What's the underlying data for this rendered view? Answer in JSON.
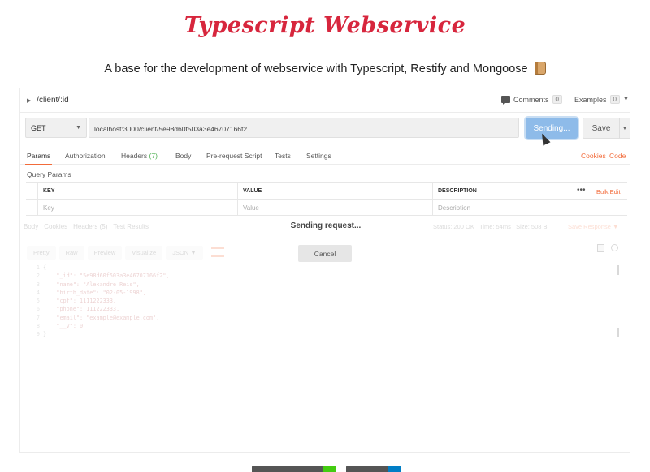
{
  "page": {
    "title": "Typescript Webservice",
    "subtitle": "A base for the development of webservice with Typescript, Restify and Mongoose"
  },
  "header": {
    "path": "/client/:id",
    "comments_label": "Comments",
    "comments_count": "0",
    "examples_label": "Examples",
    "examples_count": "0"
  },
  "request": {
    "method": "GET",
    "url": "localhost:3000/client/5e98d60f503a3e46707166f2",
    "send_label": "Sending...",
    "save_label": "Save"
  },
  "request_tabs": [
    {
      "label": "Params"
    },
    {
      "label": "Authorization"
    },
    {
      "label": "Headers",
      "count": "(7)"
    },
    {
      "label": "Body"
    },
    {
      "label": "Pre-request Script"
    },
    {
      "label": "Tests"
    },
    {
      "label": "Settings"
    }
  ],
  "links": {
    "cookies": "Cookies",
    "code": "Code"
  },
  "query_params": {
    "label": "Query Params",
    "columns": [
      "KEY",
      "VALUE",
      "DESCRIPTION"
    ],
    "placeholders": [
      "Key",
      "Value",
      "Description"
    ],
    "more": "•••",
    "bulk_edit": "Bulk Edit"
  },
  "response": {
    "tabs": [
      "Body",
      "Cookies",
      "Headers (5)",
      "Test Results"
    ],
    "status": "Status: 200 OK",
    "time": "Time: 54ms",
    "size": "Size: 508 B",
    "save_response": "Save Response",
    "views": [
      "Pretty",
      "Raw",
      "Preview",
      "Visualize",
      "JSON"
    ],
    "code_lines": [
      "{",
      "    \"_id\": \"5e98d60f503a3e46707166f2\",",
      "    \"name\": \"Alexandre Reis\",",
      "    \"birth_date\": \"02-05-1998\",",
      "    \"cpf\": 1111222333,",
      "    \"phone\": 111222333,",
      "    \"email\": \"example@example.com\",",
      "    \"__v\": 0",
      "}"
    ]
  },
  "overlay": {
    "sending_text": "Sending request...",
    "cancel_label": "Cancel"
  }
}
